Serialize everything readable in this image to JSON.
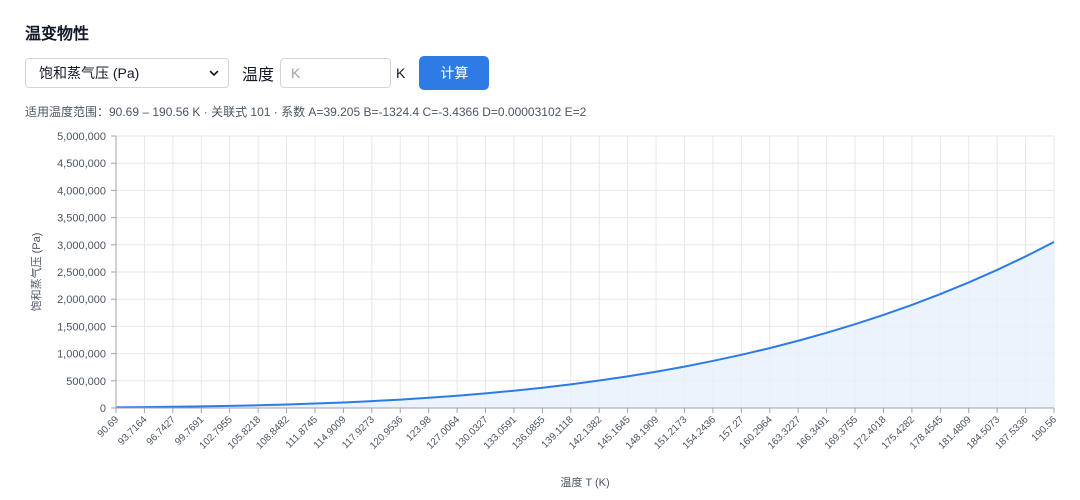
{
  "page": {
    "title": "温变物性"
  },
  "controls": {
    "property_selected": "饱和蒸气压 (Pa)",
    "temp_label": "温度",
    "temp_input_value": "",
    "temp_input_placeholder": "K",
    "unit_label": "K",
    "calc_button_label": "计算"
  },
  "range_info": "适用温度范围：90.69 – 190.56 K · 关联式 101 · 系数 A=39.205 B=-1324.4 C=-3.4366 D=0.00003102 E=2",
  "icons": {
    "select_chevron": "chevron-down-icon"
  },
  "colors": {
    "accent": "#2f7be5",
    "line": "#2f7be5",
    "area_fill": "#e8f1fc",
    "grid": "#e5e7eb"
  },
  "chart_data": {
    "type": "area",
    "xlabel": "温度 T (K)",
    "ylabel": "饱和蒸气压 (Pa)",
    "ylim": [
      0,
      5000000
    ],
    "xlim": [
      90.69,
      190.56
    ],
    "y_ticks": [
      0,
      500000,
      1000000,
      1500000,
      2000000,
      2500000,
      3000000,
      3500000,
      4000000,
      4500000,
      5000000
    ],
    "y_tick_labels": [
      "0",
      "500,000",
      "1,000,000",
      "1,500,000",
      "2,000,000",
      "2,500,000",
      "3,000,000",
      "3,500,000",
      "4,000,000",
      "4,500,000",
      "5,000,000"
    ],
    "x_tick_labels": [
      "90.69",
      "93.7164",
      "96.7427",
      "99.7691",
      "102.7955",
      "105.8218",
      "108.8482",
      "111.8745",
      "114.9009",
      "117.9273",
      "120.9536",
      "123.98",
      "127.0064",
      "130.0327",
      "133.0591",
      "136.0855",
      "139.1118",
      "142.1382",
      "145.1645",
      "148.1909",
      "151.2173",
      "154.2436",
      "157.27",
      "160.2964",
      "163.3227",
      "166.3491",
      "169.3755",
      "172.4018",
      "175.4282",
      "178.4545",
      "181.4809",
      "184.5073",
      "187.5336",
      "190.56"
    ],
    "grid": true,
    "legend": "none",
    "series": [
      {
        "x": [
          90.69,
          93.7164,
          96.7427,
          99.7691,
          102.7955,
          105.8218,
          108.8482,
          111.8745,
          114.9009,
          117.9273,
          120.9536,
          123.98,
          127.0064,
          130.0327,
          133.0591,
          136.0855,
          139.1118,
          142.1382,
          145.1645,
          148.1909,
          151.2173,
          154.2436,
          157.27,
          160.2964,
          163.3227,
          166.3491,
          169.3755,
          172.4018,
          175.4282,
          178.4545,
          181.4809,
          184.5073,
          187.5336,
          190.56
        ],
        "values": [
          11700,
          16000,
          21800,
          29300,
          38700,
          50200,
          64500,
          81800,
          102000,
          127000,
          155000,
          188000,
          226000,
          269000,
          318000,
          373000,
          435000,
          505000,
          582000,
          667000,
          761000,
          865000,
          978000,
          1101000,
          1236000,
          1382000,
          1540000,
          1711000,
          1895000,
          2094000,
          2308000,
          2538000,
          2786000,
          3052000
        ]
      }
    ]
  }
}
